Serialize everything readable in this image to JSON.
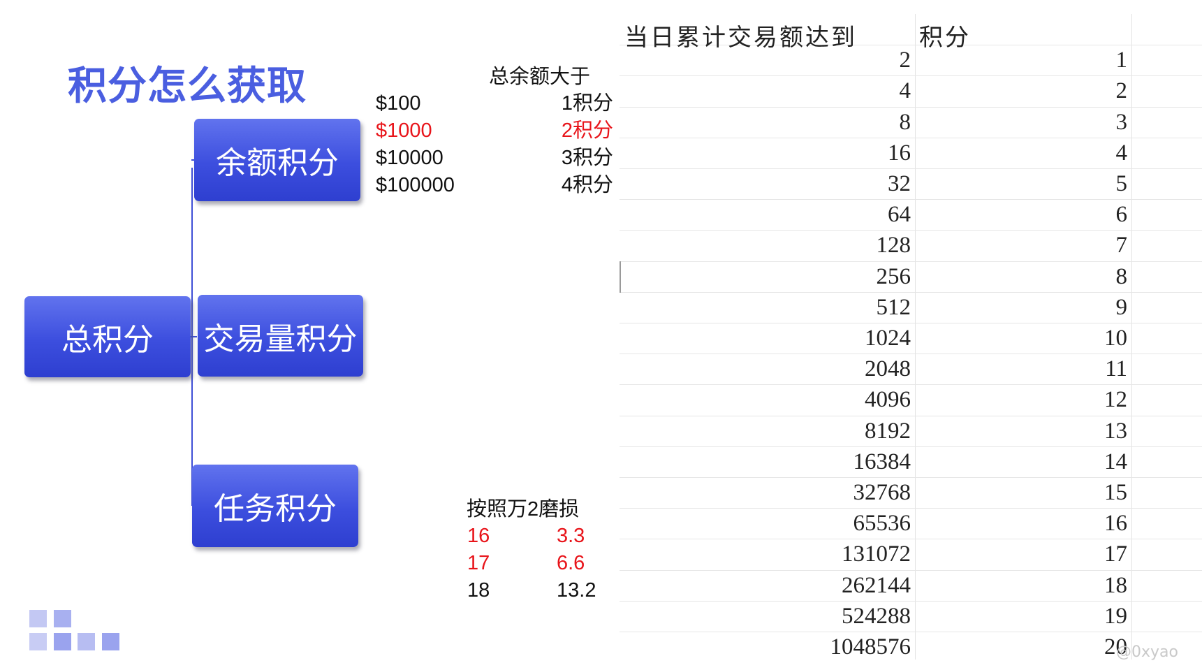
{
  "title": "积分怎么获取",
  "boxes": {
    "total": "总积分",
    "balance": "余额积分",
    "volume": "交易量积分",
    "task": "任务积分"
  },
  "balance_section": {
    "header": "总余额大于",
    "rows": [
      {
        "amount": "$100",
        "points": "1积分",
        "highlight": false
      },
      {
        "amount": "$1000",
        "points": "2积分",
        "highlight": true
      },
      {
        "amount": "$10000",
        "points": "3积分",
        "highlight": false
      },
      {
        "amount": "$100000",
        "points": "4积分",
        "highlight": false
      }
    ]
  },
  "wear_section": {
    "header": "按照万2磨损",
    "rows": [
      {
        "points": "16",
        "value": "3.3",
        "highlight": true
      },
      {
        "points": "17",
        "value": "6.6",
        "highlight": true
      },
      {
        "points": "18",
        "value": "13.2",
        "highlight": false
      }
    ]
  },
  "table": {
    "headers": [
      "当日累计交易额达到",
      "积分"
    ],
    "rows": [
      [
        "2",
        "1"
      ],
      [
        "4",
        "2"
      ],
      [
        "8",
        "3"
      ],
      [
        "16",
        "4"
      ],
      [
        "32",
        "5"
      ],
      [
        "64",
        "6"
      ],
      [
        "128",
        "7"
      ],
      [
        "256",
        "8"
      ],
      [
        "512",
        "9"
      ],
      [
        "1024",
        "10"
      ],
      [
        "2048",
        "11"
      ],
      [
        "4096",
        "12"
      ],
      [
        "8192",
        "13"
      ],
      [
        "16384",
        "14"
      ],
      [
        "32768",
        "15"
      ],
      [
        "65536",
        "16"
      ],
      [
        "131072",
        "17"
      ],
      [
        "262144",
        "18"
      ],
      [
        "524288",
        "19"
      ],
      [
        "1048576",
        "20"
      ]
    ]
  },
  "watermark": "@0xyao",
  "colors": {
    "title": "#4a5ee0",
    "box": "#3c4ede",
    "highlight_red": "#e8141a",
    "logo": "#9aa3ee"
  }
}
